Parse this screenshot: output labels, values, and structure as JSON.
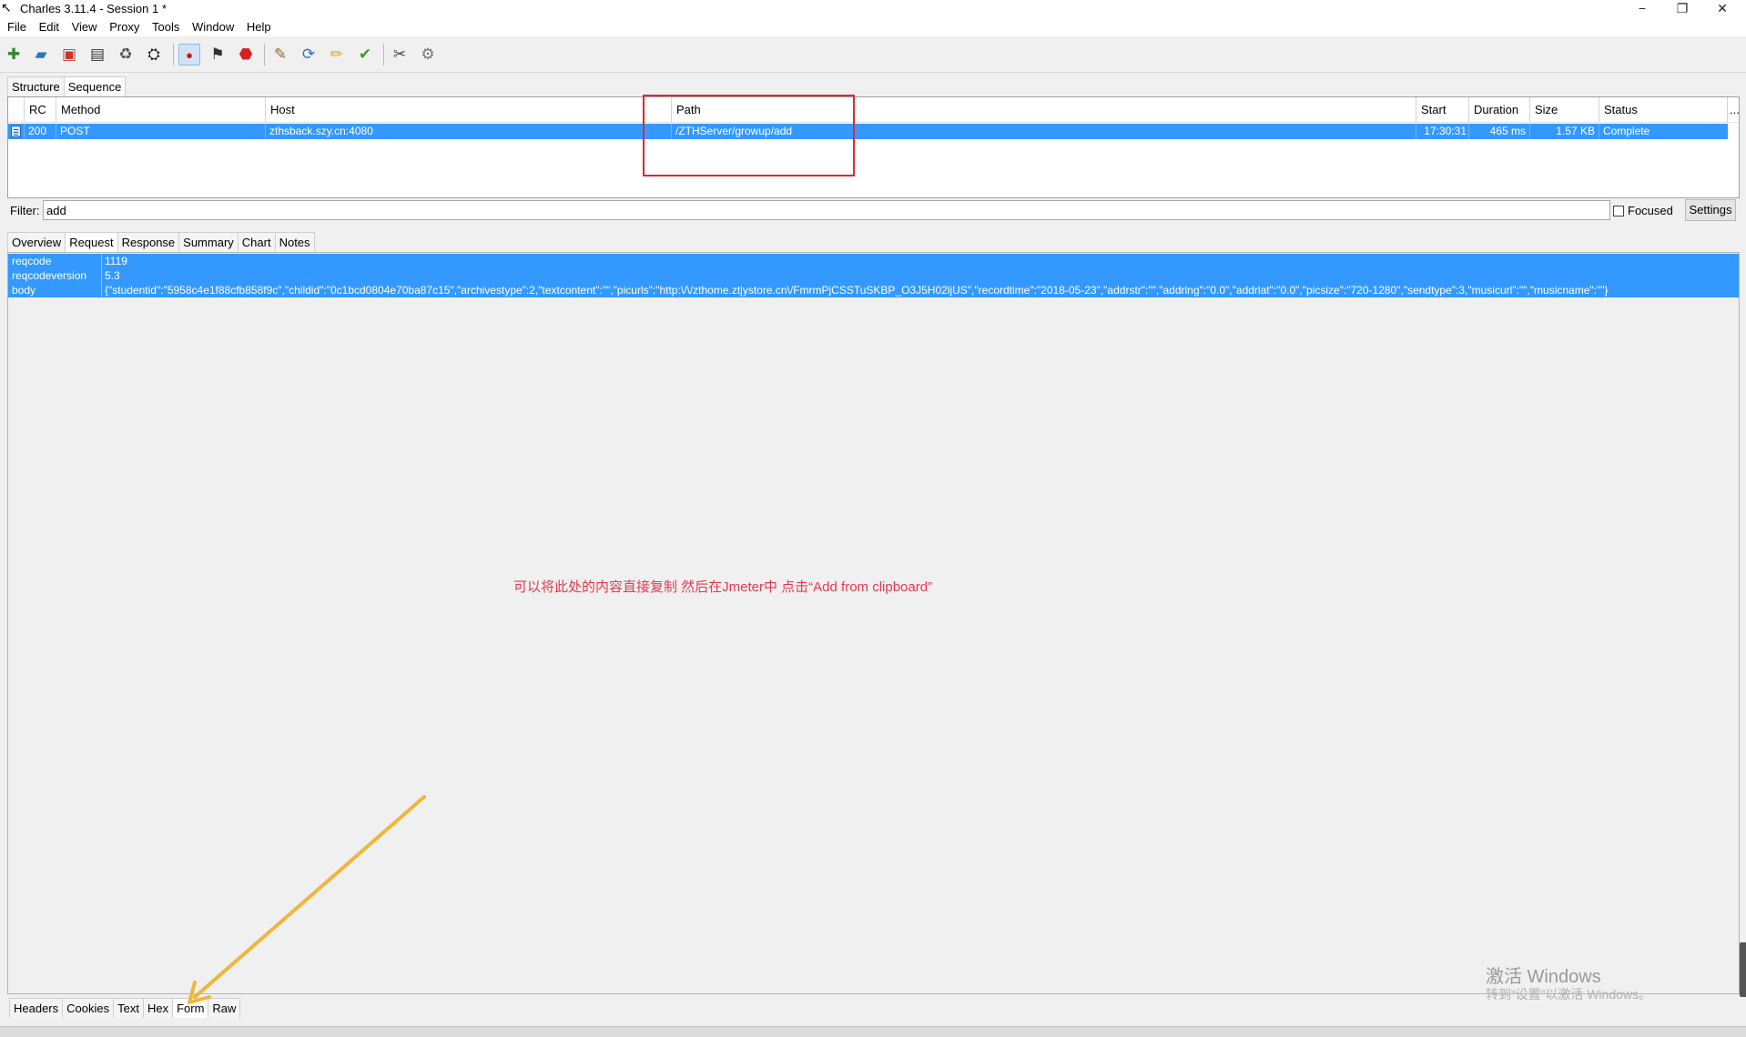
{
  "window": {
    "title": "Charles 3.11.4 - Session 1 *",
    "minimize": "−",
    "maximize": "❐",
    "close": "✕"
  },
  "menu": [
    "File",
    "Edit",
    "View",
    "Proxy",
    "Tools",
    "Window",
    "Help"
  ],
  "toolbar_icons": [
    "new-session-icon",
    "open-session-icon",
    "close-session-icon",
    "save-icon",
    "clear-icon",
    "find-icon",
    "record-icon",
    "throttle-icon",
    "stop-icon",
    "compose-icon",
    "repeat-icon",
    "edit-icon",
    "validate-icon",
    "tools-icon",
    "settings-icon"
  ],
  "view_tabs": [
    "Structure",
    "Sequence"
  ],
  "table": {
    "columns": [
      "RC",
      "Method",
      "Host",
      "Path",
      "Start",
      "Duration",
      "Size",
      "Status",
      "..."
    ],
    "rows": [
      {
        "rc": "200",
        "method": "POST",
        "host": "zthsback.szy.cn:4080",
        "path": "/ZTHServer/growup/add",
        "start": "17:30:31",
        "duration": "465 ms",
        "size": "1.57 KB",
        "status": "Complete"
      }
    ]
  },
  "filter": {
    "label": "Filter:",
    "value": "add",
    "focused_label": "Focused",
    "settings_label": "Settings"
  },
  "detail_tabs": [
    "Overview",
    "Request",
    "Response",
    "Summary",
    "Chart",
    "Notes"
  ],
  "params": [
    {
      "name": "reqcode",
      "value": "1119"
    },
    {
      "name": "reqcodeversion",
      "value": "5.3"
    },
    {
      "name": "body",
      "value": "{\"studentid\":\"5958c4e1f88cfb858f9c\",\"childid\":\"0c1bcd0804e70ba87c15\",\"archivestype\":2,\"textcontent\":\"\",\"picurls\":\"http:\\/\\/zthome.ztjystore.cn\\/FmrmPjCSSTuSKBP_O3J5H02ljUS\",\"recordtime\":\"2018-05-23\",\"addrstr\":\"\",\"addrlng\":\"0.0\",\"addrlat\":\"0.0\",\"picsize\":\"720-1280\",\"sendtype\":3,\"musicurl\":\"\",\"musicname\":\"\"}"
    }
  ],
  "annotation": "可以将此处的内容直接复制 然后在Jmeter中 点击“Add from clipboard”",
  "bottom_tabs": [
    "Headers",
    "Cookies",
    "Text",
    "Hex",
    "Form",
    "Raw"
  ],
  "watermark": {
    "line1": "激活 Windows",
    "line2": "转到“设置”以激活 Windows。"
  },
  "colors": {
    "selection": "#3399ff",
    "annotation_red": "#e8384b",
    "highlight_box": "#e0282e",
    "arrow": "#f0b63c"
  }
}
